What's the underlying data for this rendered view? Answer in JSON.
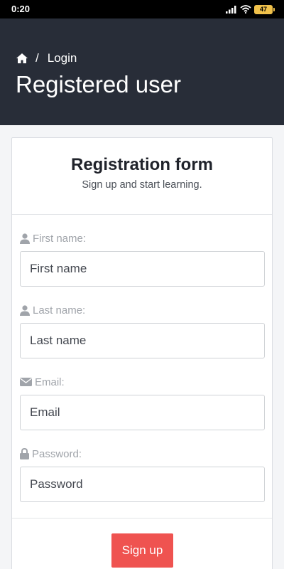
{
  "status_bar": {
    "time": "0:20",
    "battery": "47"
  },
  "breadcrumb": {
    "home_icon": "home-icon",
    "separator": "/",
    "current": "Login"
  },
  "page": {
    "title": "Registered user"
  },
  "form": {
    "title": "Registration form",
    "subtitle": "Sign up and start learning.",
    "fields": [
      {
        "icon": "user-icon",
        "label": "First name:",
        "placeholder": "First name",
        "value": ""
      },
      {
        "icon": "user-icon",
        "label": "Last name:",
        "placeholder": "Last name",
        "value": ""
      },
      {
        "icon": "envelope-icon",
        "label": "Email:",
        "placeholder": "Email",
        "value": ""
      },
      {
        "icon": "lock-icon",
        "label": "Password:",
        "placeholder": "Password",
        "value": ""
      }
    ],
    "submit_label": "Sign up"
  },
  "colors": {
    "header_bg": "#282d38",
    "primary_button": "#ef5350",
    "page_bg": "#f4f5f7",
    "label_gray": "#a0a4aa"
  }
}
